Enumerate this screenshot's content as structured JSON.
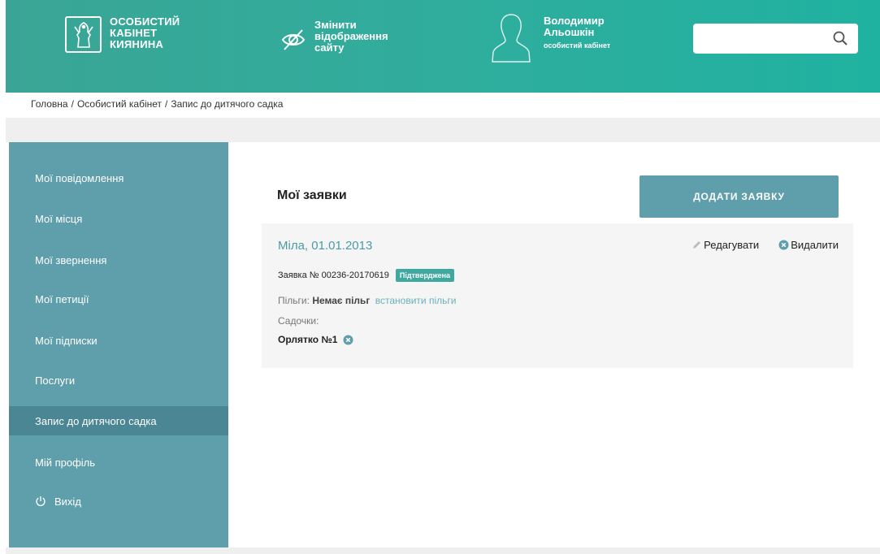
{
  "header": {
    "logo_text": "ОСОБИСТИЙ КАБІНЕТ КИЯНИНА",
    "view_switch": "Змінити відображення сайту",
    "user_name": "Володимир Альошкін",
    "user_sub": "особистий кабінет",
    "search_placeholder": ""
  },
  "breadcrumb": {
    "items": [
      "Головна",
      "Особистий кабінет",
      "Запис до дитячого садка"
    ],
    "separator": "/"
  },
  "sidebar": {
    "items": [
      {
        "label": "Мої повідомлення"
      },
      {
        "label": "Мої місця"
      },
      {
        "label": "Мої звернення"
      },
      {
        "label": "Мої петиції"
      },
      {
        "label": "Мої підписки"
      },
      {
        "label": "Послуги"
      },
      {
        "label": "Запис до дитячого садка",
        "active": true
      },
      {
        "label": "Мій профіль"
      },
      {
        "label": "Вихід",
        "icon": "power-icon"
      }
    ]
  },
  "main": {
    "title": "Мої заявки",
    "add_button": "ДОДАТИ ЗАЯВКУ",
    "card": {
      "title": "Міла, 01.01.2013",
      "edit_label": "Редагувати",
      "delete_label": "Видалити",
      "request_text": "Заявка № 00236-20170619",
      "status_badge": "Підтверджена",
      "benefits_label": "Пільги:",
      "benefits_value": "Немає пільг",
      "benefits_link": "встановити пільги",
      "kindergartens_label": "Садочки:",
      "kindergarten_item": "Орлятко №1"
    }
  },
  "colors": {
    "header_start": "#3aa596",
    "header_end": "#20b2a0",
    "sidebar": "#5f9eab",
    "sidebar_active": "#4a8693",
    "badge": "#3fa9a0",
    "link": "#4a9aa8"
  }
}
